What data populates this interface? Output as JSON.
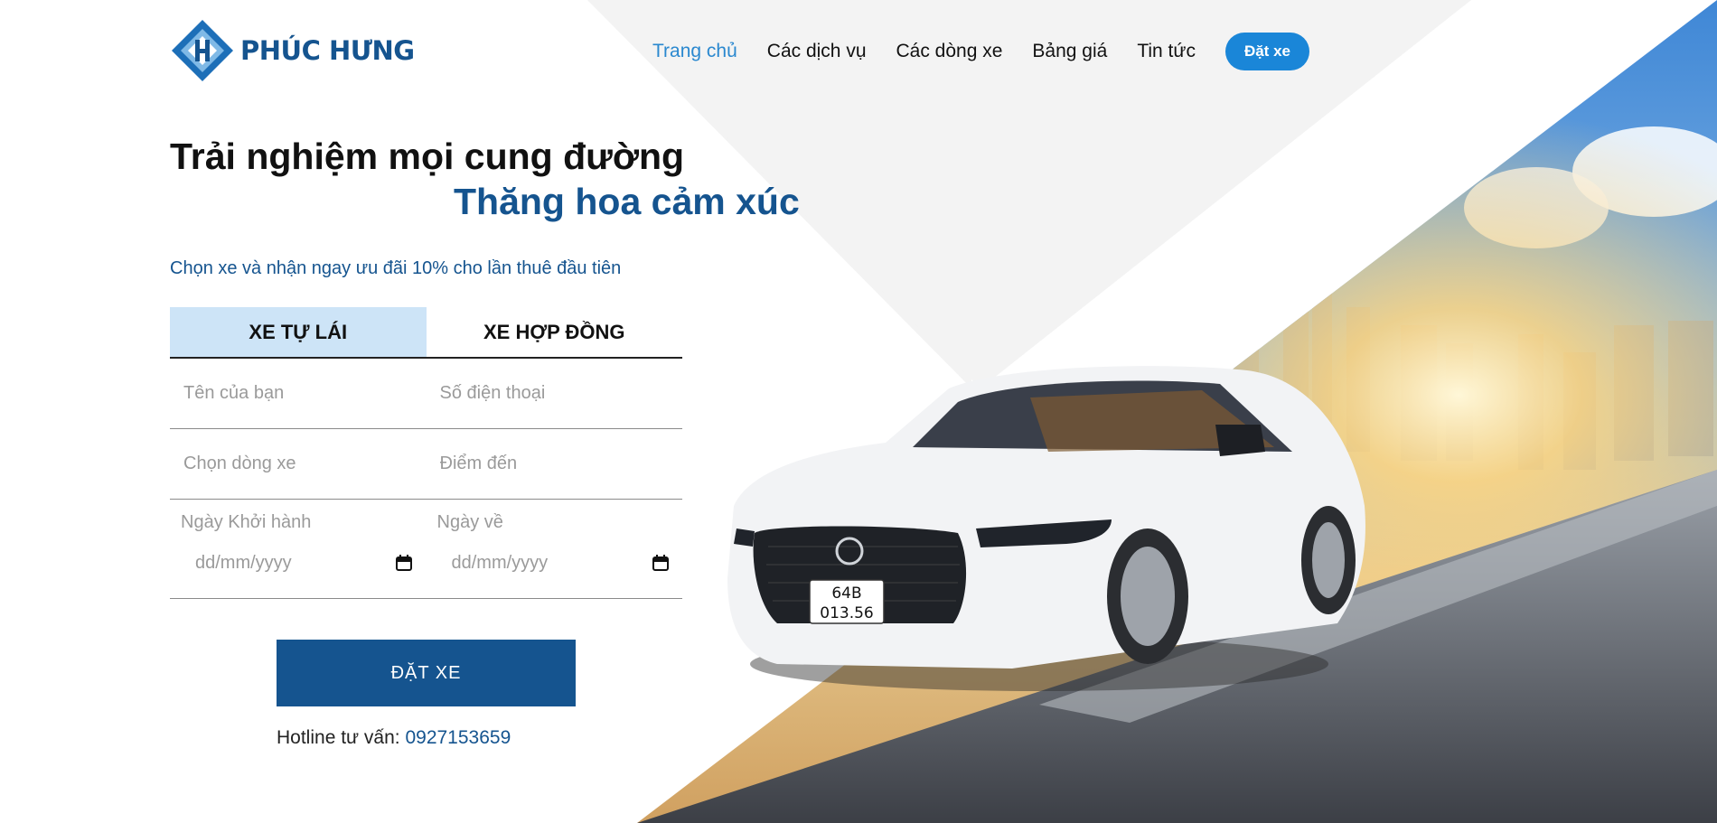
{
  "brand": {
    "name": "PHÚC HƯNG",
    "color": "#15548f",
    "icon": "ph-diamond-logo-icon"
  },
  "nav": {
    "items": [
      {
        "label": "Trang chủ",
        "active": true
      },
      {
        "label": "Các dịch vụ",
        "active": false
      },
      {
        "label": "Các dòng xe",
        "active": false
      },
      {
        "label": "Bảng giá",
        "active": false
      },
      {
        "label": "Tin tức",
        "active": false
      }
    ],
    "cta_label": "Đặt xe",
    "active_color": "#2a88cf",
    "cta_color": "#1a86d8"
  },
  "hero": {
    "headline_1": "Trải nghiệm mọi cung đường",
    "headline_2": "Thăng hoa cảm xúc",
    "promo": "Chọn xe và nhận ngay ưu đãi 10% cho lần thuê đầu tiên",
    "plate_line_1": "64B",
    "plate_line_2": "013.56"
  },
  "tabs": [
    {
      "label": "XE TỰ LÁI",
      "active": true
    },
    {
      "label": "XE HỢP ĐỒNG",
      "active": false
    }
  ],
  "form": {
    "name_placeholder": "Tên của bạn",
    "phone_placeholder": "Số điện thoại",
    "model_placeholder": "Chọn dòng xe",
    "destination_placeholder": "Điểm đến",
    "depart_label": "Ngày Khởi hành",
    "return_label": "Ngày về",
    "date_placeholder": "dd/mm/yyyy",
    "submit_label": "ĐẶT XE"
  },
  "hotline": {
    "label": "Hotline tư vấn:",
    "phone": "0927153659"
  }
}
